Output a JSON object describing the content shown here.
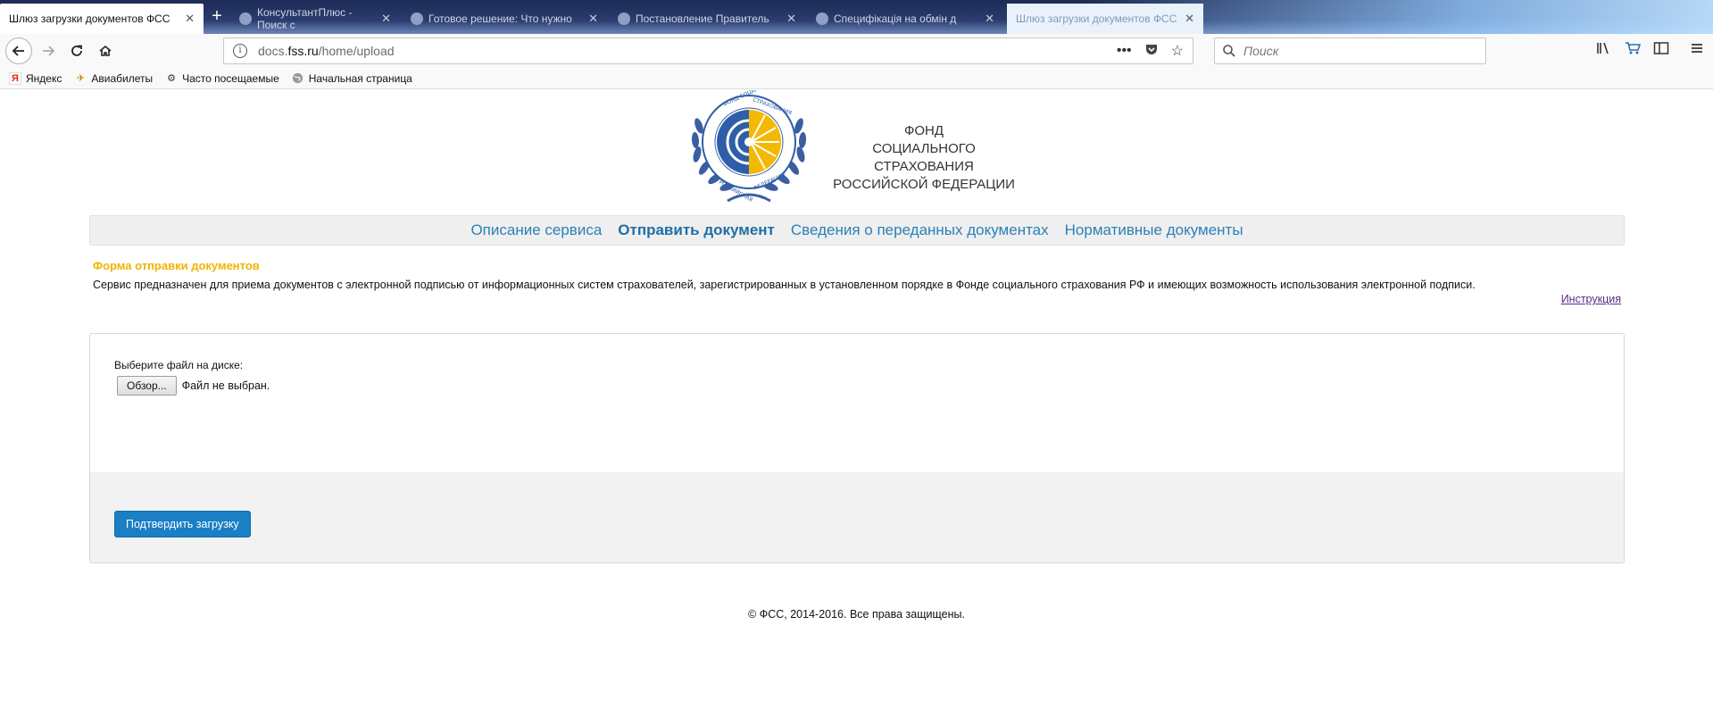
{
  "browser": {
    "tabs": [
      {
        "title": "Шлюз загрузки документов ФСС",
        "active": true
      },
      {
        "title": "КонсультантПлюс - Поиск с",
        "active": false
      },
      {
        "title": "Готовое решение: Что нужно",
        "active": false
      },
      {
        "title": "Постановление Правитель",
        "active": false
      },
      {
        "title": "Специфікація на обмін д",
        "active": false
      },
      {
        "title": "Шлюз загрузки документов ФСС",
        "active": false
      }
    ],
    "address": {
      "prefix": "docs.",
      "domain": "fss.ru",
      "path": "/home/upload"
    },
    "search_placeholder": "Поиск",
    "bookmarks": [
      {
        "label": "Яндекс",
        "icon": "yandex-icon"
      },
      {
        "label": "Авиабилеты",
        "icon": "airplane-icon"
      },
      {
        "label": "Часто посещаемые",
        "icon": "gear-icon"
      },
      {
        "label": "Начальная страница",
        "icon": "globe-icon"
      }
    ]
  },
  "header": {
    "logo_ring_text": "ФОНД СОЦИАЛЬНОГО СТРАХОВАНИЯ · РОССИЙСКАЯ ФЕДЕРАЦИЯ",
    "org_line1": "ФОНД",
    "org_line2": "СОЦИАЛЬНОГО СТРАХОВАНИЯ",
    "org_line3": "РОССИЙСКОЙ ФЕДЕРАЦИИ"
  },
  "menu": {
    "items": [
      {
        "label": "Описание сервиса",
        "active": false
      },
      {
        "label": "Отправить документ",
        "active": true
      },
      {
        "label": "Сведения о переданных документах",
        "active": false
      },
      {
        "label": "Нормативные документы",
        "active": false
      }
    ]
  },
  "form": {
    "title": "Форма отправки документов",
    "description": "Сервис предназначен для приема документов с электронной подписью от информационных систем страхователей, зарегистрированных в установленном порядке в Фонде социального страхования РФ и имеющих возможность использования электронной подписи.",
    "instruction_link": "Инструкция",
    "file_label": "Выберите файл на диске:",
    "browse_button": "Обзор...",
    "file_status": "Файл не выбран.",
    "submit_button": "Подтвердить загрузку"
  },
  "footer": {
    "copyright": "© ФСС, 2014-2016. Все права защищены."
  },
  "colors": {
    "accent": "#2b80b8",
    "title_yellow": "#f0b400",
    "submit_blue": "#1a7fc4",
    "logo_blue": "#2f5ea8",
    "logo_yellow": "#f5b800"
  }
}
